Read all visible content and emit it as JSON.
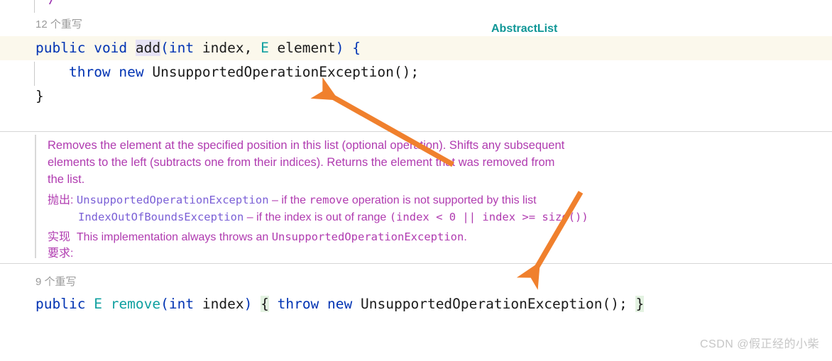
{
  "editor": {
    "clipped_comment": "/**",
    "overrides_label_top": "12 个重写",
    "class_badge_top": "AbstractList",
    "method_add": {
      "modifier": "public",
      "return_type": "void",
      "name": "add",
      "params_open": "(",
      "param1_type": "int",
      "param1_name": " index, ",
      "param2_type": "E",
      "param2_name": " element",
      "params_close": ") {",
      "body_keyword1": "throw",
      "body_keyword2": "new",
      "body_exception": "UnsupportedOperationException();",
      "closing_brace": "}"
    },
    "overrides_label_bottom": "9 个重写",
    "method_remove": {
      "modifier": "public",
      "return_type": "E",
      "name": "remove",
      "params_open": "(",
      "param1_type": "int",
      "param1_name": " index",
      "params_close": ")",
      "open_brace": "{",
      "body_keyword1": "throw",
      "body_keyword2": "new",
      "body_exception": "UnsupportedOperationException();",
      "close_brace": "}"
    }
  },
  "doc": {
    "description_line1": "Removes the element at the specified position in this list (optional operation). Shifts any subsequent",
    "description_line2": "elements to the left (subtracts one from their indices). Returns the element that was removed from",
    "description_line3": "the list.",
    "throws_label": "抛出:",
    "throws_1_type": "UnsupportedOperationException",
    "throws_1_dash": " – if the ",
    "throws_1_code": "remove",
    "throws_1_rest": " operation is not supported by this list",
    "throws_2_type": "IndexOutOfBoundsException",
    "throws_2_dash": " – if the index is out of range ",
    "throws_2_code": "(index < 0 || index >= size())",
    "impl_label": "实现",
    "impl_text_pre": "This implementation always throws an ",
    "impl_text_code": "UnsupportedOperationException",
    "impl_text_post": ".",
    "requires_label": "要求:"
  },
  "annotations": {
    "arrow_upper_name": "arrow-pointing-to-throw-statement",
    "arrow_lower_name": "arrow-pointing-to-remove-method",
    "arrow_color": "#f0802d"
  },
  "watermark": {
    "text": "CSDN @假正经的小柴"
  },
  "colors": {
    "keyword": "#0033b3",
    "type": "#10a0a0",
    "doc_text": "#b03bb0",
    "doc_code": "#7a5fd6",
    "class_badge": "#0f9696",
    "current_line_bg": "#fbf8ec",
    "identifier_highlight_bg": "#e6e2f5",
    "brace_highlight_bg": "#e3f2e1",
    "arrow": "#f0802d",
    "watermark": "#c6c6c6"
  }
}
